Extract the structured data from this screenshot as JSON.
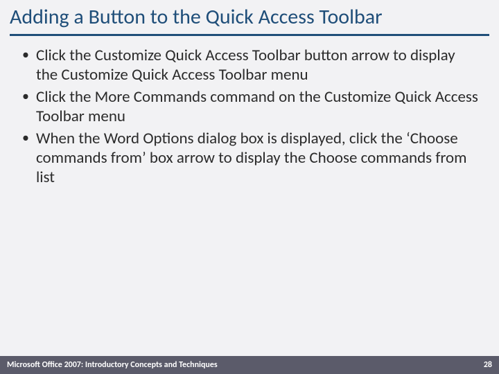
{
  "title": "Adding a Button to the Quick Access Toolbar",
  "bullets": [
    "Click the Customize Quick Access Toolbar button arrow to display the Customize Quick Access Toolbar menu",
    "Click the More Commands command on the Customize Quick Access Toolbar menu",
    "When the Word Options dialog box is displayed, click the ‘Choose commands from’ box arrow to display the Choose commands from list"
  ],
  "footer": {
    "left": "Microsoft Office 2007: Introductory Concepts and Techniques",
    "page": "28"
  }
}
